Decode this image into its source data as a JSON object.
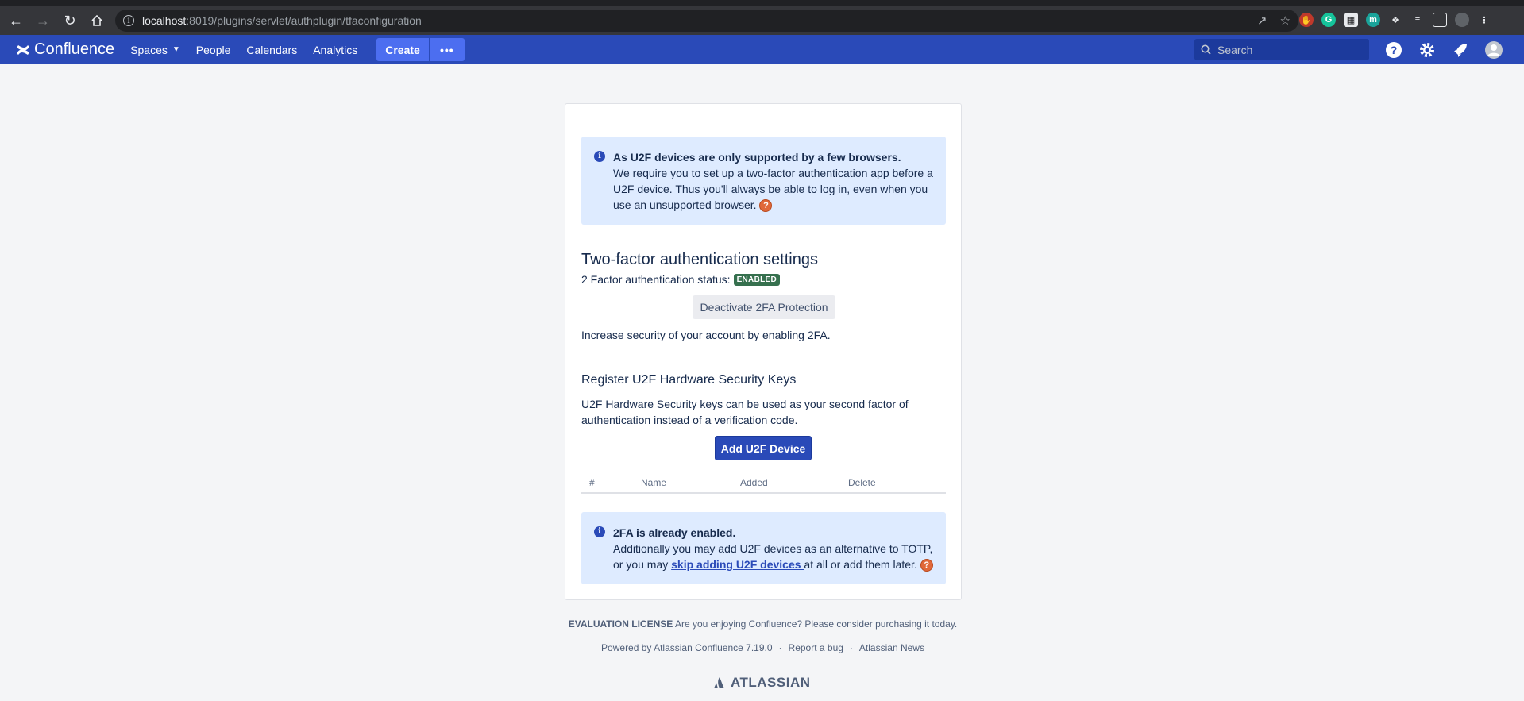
{
  "browser": {
    "url_host": "localhost",
    "url_path": ":8019/plugins/servlet/authplugin/tfaconfiguration"
  },
  "header": {
    "logo": "Confluence",
    "nav": [
      "Spaces",
      "People",
      "Calendars",
      "Analytics"
    ],
    "create_label": "Create",
    "more_label": "•••",
    "search_placeholder": "Search"
  },
  "info_box_1": {
    "title": "As U2F devices are only supported by a few browsers.",
    "body": "We require you to set up a two-factor authentication app before a U2F device. Thus you'll always be able to log in, even when you use an unsupported browser."
  },
  "tfa": {
    "heading": "Two-factor authentication settings",
    "status_label": "2 Factor authentication status:",
    "status_badge": "ENABLED",
    "deactivate_label": "Deactivate 2FA Protection",
    "increase_text": "Increase security of your account by enabling 2FA."
  },
  "u2f": {
    "heading": "Register U2F Hardware Security Keys",
    "description": "U2F Hardware Security keys can be used as your second factor of authentication instead of a verification code.",
    "add_label": "Add U2F Device",
    "columns": [
      "#",
      "Name",
      "Added",
      "Delete"
    ]
  },
  "info_box_2": {
    "title": "2FA is already enabled.",
    "body_1": "Additionally you may add U2F devices as an alternative to TOTP, or you may ",
    "link": "skip adding U2F devices ",
    "body_2": "at all or add them later."
  },
  "footer": {
    "license_label": "EVALUATION LICENSE",
    "license_text": "Are you enjoying Confluence? Please consider purchasing it today.",
    "powered": "Powered by Atlassian Confluence 7.19.0",
    "report": "Report a bug",
    "news": "Atlassian News",
    "brand": "ATLASSIAN"
  },
  "colors": {
    "header_bg": "#2a4ab8",
    "info_bg": "#deebff",
    "badge_green": "#36704e"
  }
}
